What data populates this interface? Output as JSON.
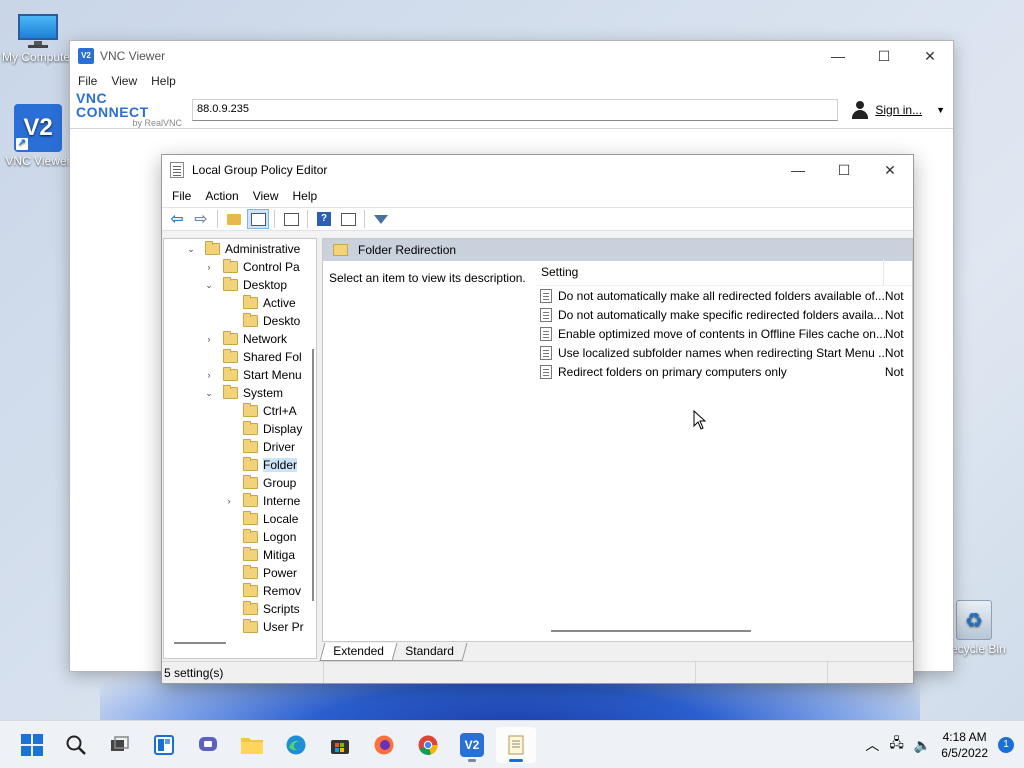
{
  "desktop": {
    "icons": [
      {
        "label": "My Computer"
      },
      {
        "label": "VNC Viewer",
        "logo": "V2"
      },
      {
        "label": "Recycle Bin"
      }
    ]
  },
  "vnc": {
    "title": "VNC Viewer",
    "logo_text": "V2",
    "menu": [
      "File",
      "View",
      "Help"
    ],
    "brand_main": "VNC CONNECT",
    "brand_sub": "by RealVNC",
    "address": "88.0.9.235",
    "signin_label": "Sign in...",
    "controls": {
      "minimize": "—",
      "maximize": "☐",
      "close": "✕"
    }
  },
  "gpe": {
    "title": "Local Group Policy Editor",
    "menu": [
      "File",
      "Action",
      "View",
      "Help"
    ],
    "controls": {
      "minimize": "—",
      "maximize": "☐",
      "close": "✕"
    },
    "tree": [
      {
        "label": "Administrative",
        "expander": "v"
      },
      {
        "label": "Control Pa",
        "expander": ">"
      },
      {
        "label": "Desktop",
        "expander": "v"
      },
      {
        "label": "Active",
        "expander": ""
      },
      {
        "label": "Deskto",
        "expander": ""
      },
      {
        "label": "Network",
        "expander": ">"
      },
      {
        "label": "Shared Fol",
        "expander": ""
      },
      {
        "label": "Start Menu",
        "expander": ">"
      },
      {
        "label": "System",
        "expander": "v"
      },
      {
        "label": "Ctrl+A",
        "expander": ""
      },
      {
        "label": "Display",
        "expander": ""
      },
      {
        "label": "Driver",
        "expander": ""
      },
      {
        "label": "Folder",
        "expander": ""
      },
      {
        "label": "Group",
        "expander": ""
      },
      {
        "label": "Interne",
        "expander": ">"
      },
      {
        "label": "Locale",
        "expander": ""
      },
      {
        "label": "Logon",
        "expander": ""
      },
      {
        "label": "Mitiga",
        "expander": ""
      },
      {
        "label": "Power",
        "expander": ""
      },
      {
        "label": "Remov",
        "expander": ""
      },
      {
        "label": "Scripts",
        "expander": ""
      },
      {
        "label": "User Pr",
        "expander": ""
      }
    ],
    "right": {
      "header": "Folder Redirection",
      "description": "Select an item to view its description.",
      "columns": {
        "setting": "Setting",
        "state": ""
      },
      "settings": [
        {
          "name": "Do not automatically make all redirected folders available of...",
          "state": "Not"
        },
        {
          "name": "Do not automatically make specific redirected folders availa...",
          "state": "Not"
        },
        {
          "name": "Enable optimized move of contents in Offline Files cache on...",
          "state": "Not"
        },
        {
          "name": "Use localized subfolder names when redirecting Start Menu ...",
          "state": "Not"
        },
        {
          "name": "Redirect folders on primary computers only",
          "state": "Not"
        }
      ]
    },
    "tabs": {
      "extended": "Extended",
      "standard": "Standard"
    },
    "status": "5 setting(s)"
  },
  "taskbar": {
    "time": "4:18 AM",
    "date": "6/5/2022",
    "notifications": "1"
  }
}
